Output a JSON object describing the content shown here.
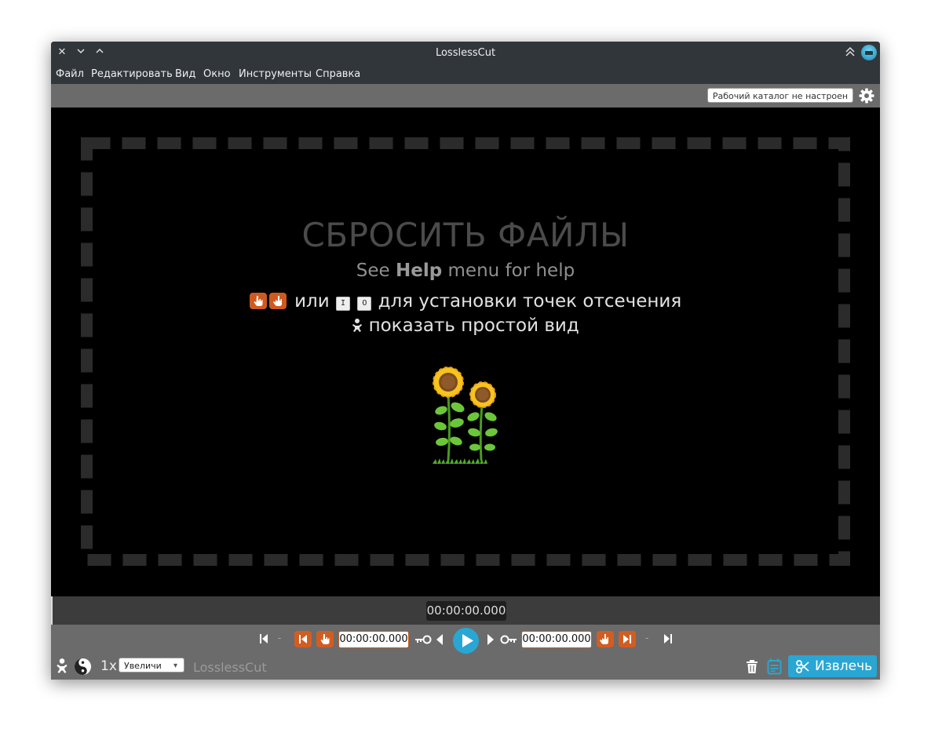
{
  "window": {
    "title": "LosslessCut"
  },
  "menu": [
    "Файл",
    "Редактировать",
    "Вид",
    "Окно",
    "Инструменты",
    "Справка"
  ],
  "toolbar": {
    "workdir_label": "Рабочий каталог не настроен"
  },
  "dropzone": {
    "title": "СБРОСИТЬ ФАЙЛЫ",
    "help_see": "See",
    "help_bold": "Help",
    "help_rest": "menu for help",
    "or_text": "или",
    "key_in": "I",
    "key_out": "O",
    "cut_points_text": "для установки точек отсечения",
    "simple_mode_text": "показать простой вид"
  },
  "timeline": {
    "current_time": "00:00:00.000"
  },
  "controls": {
    "separator": "-",
    "cut_start_time": "00:00:00.000",
    "cut_end_time": "00:00:00.000",
    "speed": "1x",
    "zoom_value": "Увеличи",
    "brand": "LosslessCut",
    "export_label": "Извлечь"
  },
  "colors": {
    "accent": "#29a6d4",
    "cut_orange": "#d25d21",
    "bar_gray": "#6b6b6b",
    "titlebar": "#31363b"
  }
}
